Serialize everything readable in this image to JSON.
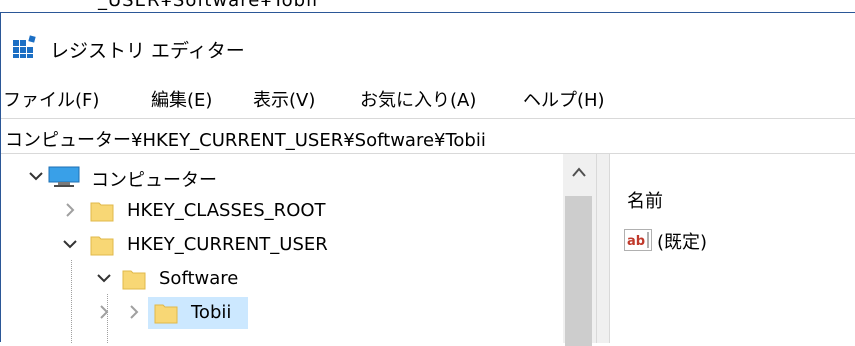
{
  "background_window": {
    "title_fragment": "_USER¥Software¥Tobii"
  },
  "window": {
    "title": "レジストリ エディター"
  },
  "menu": [
    {
      "label": "ファイル(F)"
    },
    {
      "label": "編集(E)"
    },
    {
      "label": "表示(V)"
    },
    {
      "label": "お気に入り(A)"
    },
    {
      "label": "ヘルプ(H)"
    }
  ],
  "address": {
    "path": "コンピューター¥HKEY_CURRENT_USER¥Software¥Tobii"
  },
  "tree": {
    "root": "コンピューター",
    "items": [
      {
        "label": "HKEY_CLASSES_ROOT",
        "expanded": false
      },
      {
        "label": "HKEY_CURRENT_USER",
        "expanded": true
      },
      {
        "label": "Software",
        "expanded": true
      },
      {
        "label": "Tobii",
        "expanded": false,
        "selected": true
      }
    ]
  },
  "values": {
    "columns": [
      {
        "label": "名前"
      }
    ],
    "rows": [
      {
        "name": "(既定)",
        "type_icon": "string-value-icon"
      }
    ]
  },
  "colors": {
    "selection": "#cce8ff",
    "folder": "#f8d775",
    "accent": "#2b5797"
  }
}
